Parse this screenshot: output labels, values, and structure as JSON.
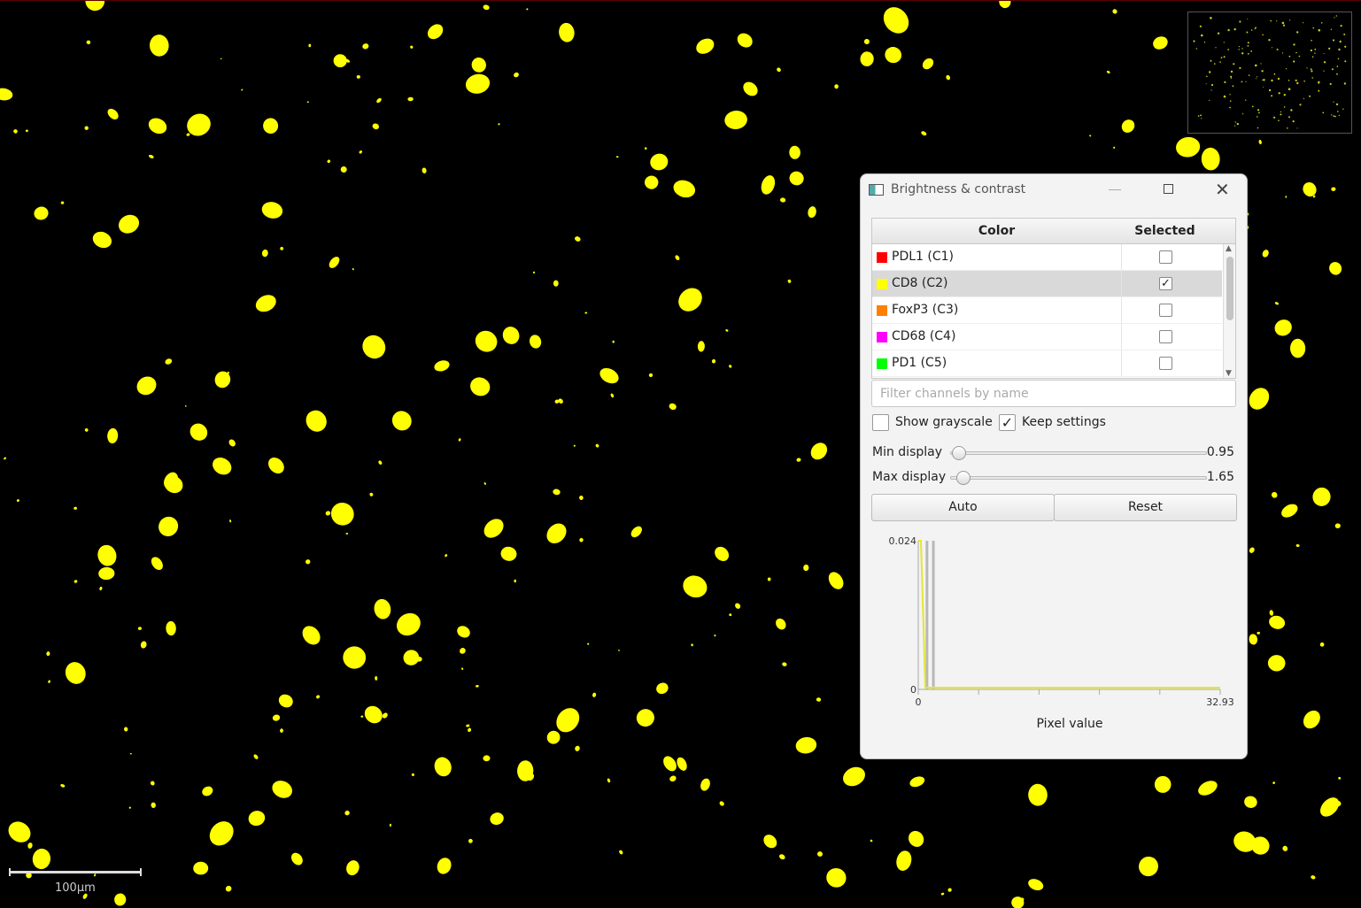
{
  "viewer": {
    "scale_label": "100µm",
    "marker_color": "#ffff00"
  },
  "dialog": {
    "title": "Brightness & contrast",
    "table": {
      "headers": {
        "color": "Color",
        "selected": "Selected"
      },
      "channels": [
        {
          "name": "PDL1 (C1)",
          "color": "#ff0000",
          "selected": false
        },
        {
          "name": "CD8 (C2)",
          "color": "#ffff00",
          "selected": true
        },
        {
          "name": "FoxP3 (C3)",
          "color": "#ff8000",
          "selected": false
        },
        {
          "name": "CD68 (C4)",
          "color": "#ff00ff",
          "selected": false
        },
        {
          "name": "PD1 (C5)",
          "color": "#00ff00",
          "selected": false
        }
      ]
    },
    "filter": {
      "placeholder": "Filter channels by name",
      "value": ""
    },
    "options": {
      "show_grayscale": {
        "label": "Show grayscale",
        "checked": false
      },
      "keep_settings": {
        "label": "Keep settings",
        "checked": true
      }
    },
    "sliders": {
      "min": {
        "label": "Min display",
        "value": "0.95"
      },
      "max": {
        "label": "Max display",
        "value": "1.65"
      }
    },
    "buttons": {
      "auto": "Auto",
      "reset": "Reset"
    },
    "histogram": {
      "xlabel": "Pixel value",
      "x_min_label": "0",
      "x_max_label": "32.93",
      "y_max_label": "0.024",
      "y_min_label": "0",
      "x_range": [
        0,
        32.93
      ],
      "y_range": [
        0,
        0.024
      ],
      "min_display": 0.95,
      "max_display": 1.65,
      "series_color": "#e6e632"
    }
  }
}
